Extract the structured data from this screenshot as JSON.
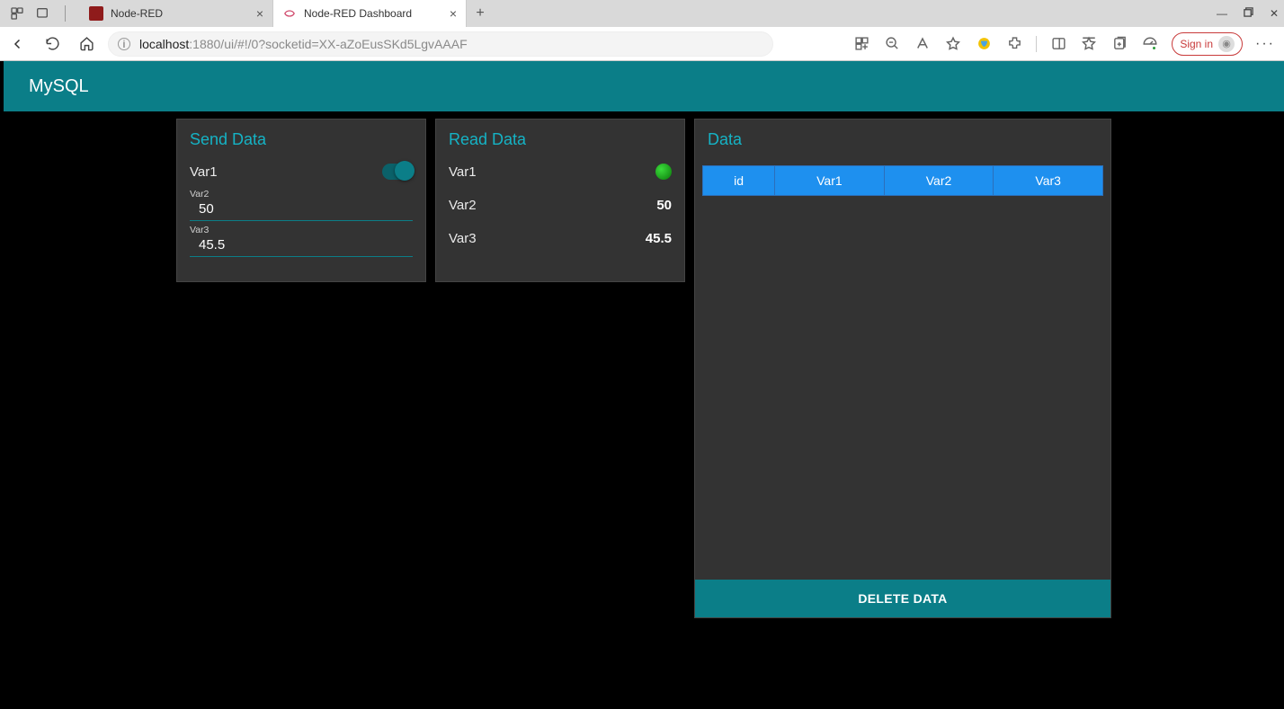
{
  "browser": {
    "tabs": [
      {
        "title": "Node-RED",
        "active": false
      },
      {
        "title": "Node-RED Dashboard",
        "active": true
      }
    ],
    "url_prefix": "localhost",
    "url_rest": ":1880/ui/#!/0?socketid=XX-aZoEusSKd5LgvAAAF",
    "signin_label": "Sign in"
  },
  "app": {
    "title": "MySQL",
    "send": {
      "title": "Send Data",
      "var1_label": "Var1",
      "var2_label": "Var2",
      "var2_value": "50",
      "var3_label": "Var3",
      "var3_value": "45.5"
    },
    "read": {
      "title": "Read Data",
      "rows": [
        {
          "label": "Var1",
          "value": ""
        },
        {
          "label": "Var2",
          "value": "50"
        },
        {
          "label": "Var3",
          "value": "45.5"
        }
      ]
    },
    "data": {
      "title": "Data",
      "headers": [
        "id",
        "Var1",
        "Var2",
        "Var3"
      ],
      "delete_label": "DELETE DATA"
    }
  }
}
